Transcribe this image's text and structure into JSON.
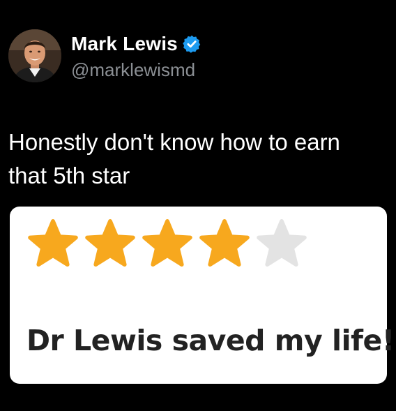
{
  "author": {
    "display_name": "Mark Lewis",
    "handle": "@marklewismd",
    "verified": true,
    "verified_icon": "verified-badge-icon",
    "verified_color": "#1d9bf0"
  },
  "tweet": {
    "line1": "Honestly don't know how to earn",
    "line2": "that 5th star"
  },
  "review_card": {
    "rating": 4,
    "max_rating": 5,
    "star_icon": "star-icon",
    "filled_color": "#f7a81e",
    "empty_color": "#e3e3e3",
    "review_text": "Dr Lewis saved my life!"
  }
}
